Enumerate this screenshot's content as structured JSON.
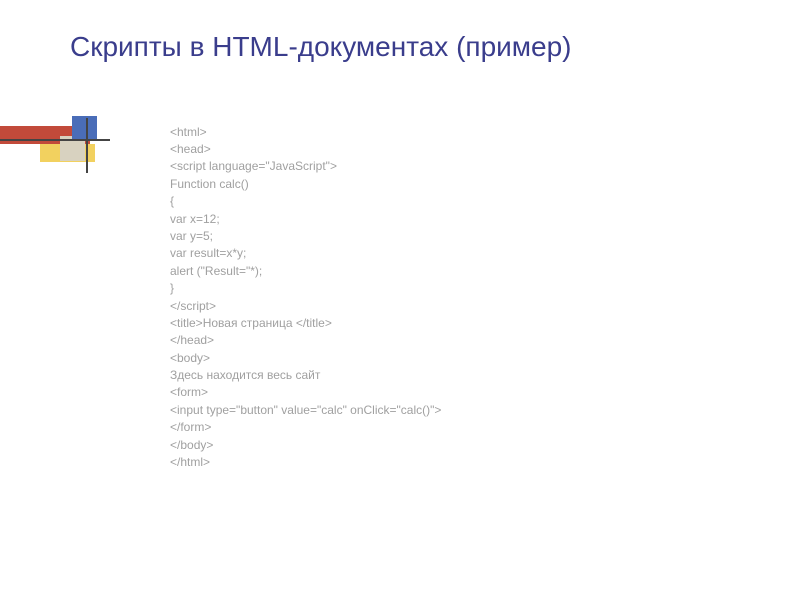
{
  "title": "Скрипты в HTML-документах (пример)",
  "code_lines": [
    "<html>",
    "<head>",
    "<script language=\"JavaScript\">",
    "Function calc()",
    "{",
    "var x=12;",
    "var y=5;",
    "var result=x*y;",
    "alert (\"Result=\"*);",
    "}",
    "</script>",
    "<title>Новая страница </title>",
    "</head>",
    "<body>",
    "Здесь находится весь сайт",
    "<form>",
    "<input type=\"button\" value=\"calc\" onClick=\"calc()\">",
    "</form>",
    "</body>",
    "</html>"
  ]
}
